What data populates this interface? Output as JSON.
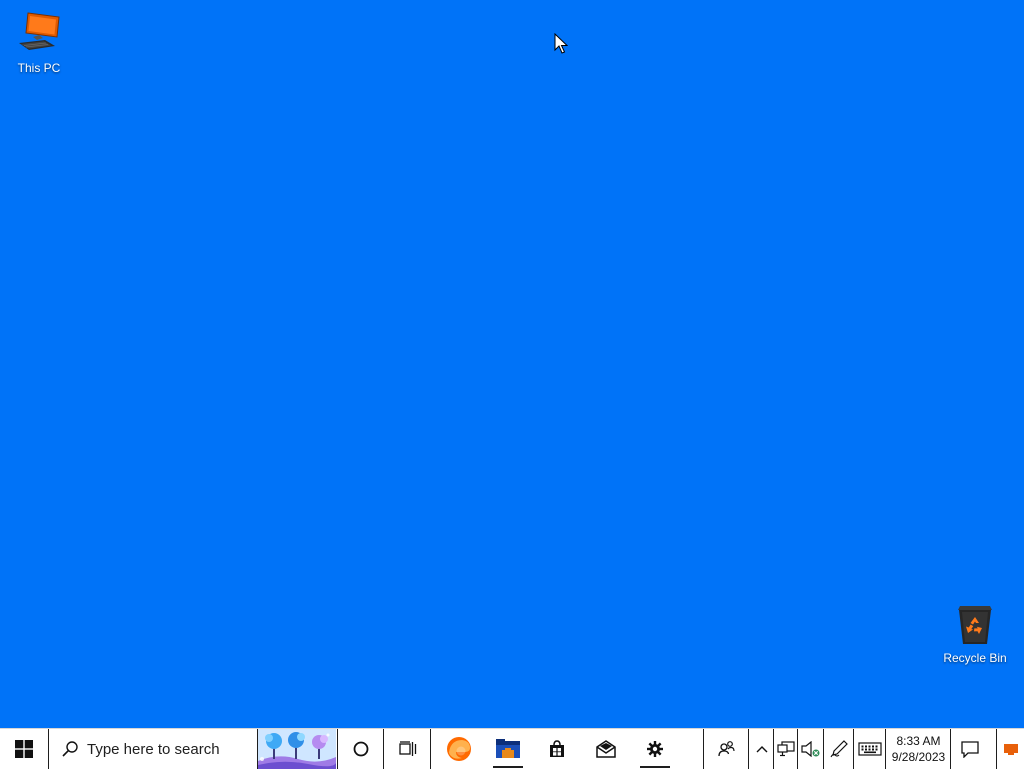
{
  "desktop": {
    "background_color": "#0073f8",
    "icons": [
      {
        "label": "This PC",
        "icon": "computer-icon"
      },
      {
        "label": "Recycle Bin",
        "icon": "recycle-bin-icon"
      }
    ]
  },
  "taskbar": {
    "search_placeholder": "Type here to search",
    "pinned_apps": [
      {
        "name": "Microsoft Edge",
        "icon": "edge-icon",
        "active": false
      },
      {
        "name": "File Explorer",
        "icon": "file-explorer-icon",
        "active": true
      },
      {
        "name": "Microsoft Store",
        "icon": "store-icon",
        "active": false
      },
      {
        "name": "Mail",
        "icon": "mail-icon",
        "active": false
      },
      {
        "name": "Settings",
        "icon": "settings-icon",
        "active": true
      }
    ],
    "clock": {
      "time": "8:33 AM",
      "date": "9/28/2023"
    }
  }
}
